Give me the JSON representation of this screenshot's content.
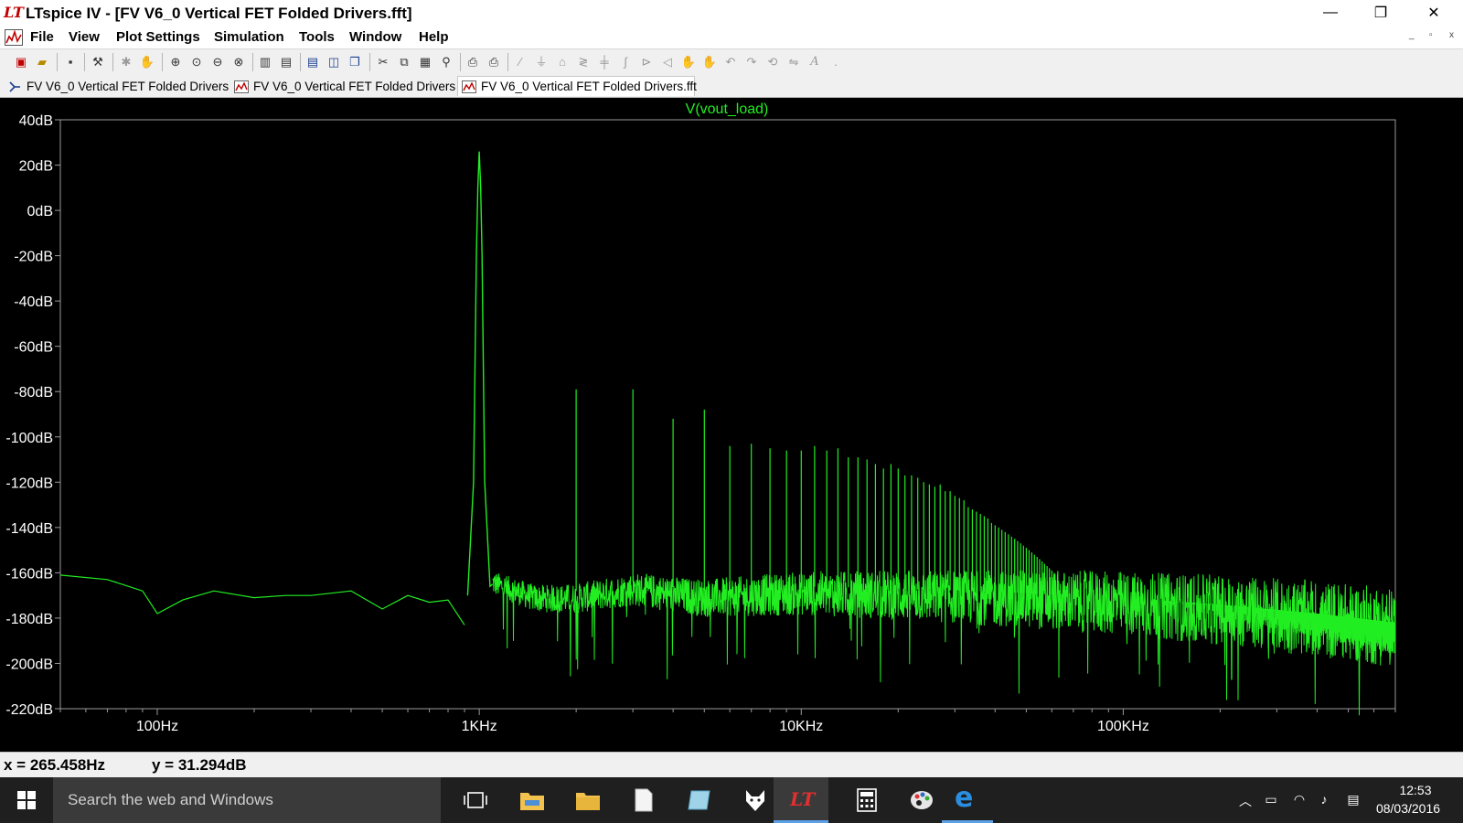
{
  "window": {
    "app_icon_label": "LT",
    "title": "LTspice IV - [FV V6_0 Vertical FET Folded Drivers.fft]",
    "minimize_glyph": "—",
    "restore_glyph": "❐",
    "close_glyph": "✕"
  },
  "menu": {
    "items": [
      {
        "label": "File",
        "id": "file"
      },
      {
        "label": "View",
        "id": "view"
      },
      {
        "label": "Plot Settings",
        "id": "plot-settings"
      },
      {
        "label": "Simulation",
        "id": "simulation"
      },
      {
        "label": "Tools",
        "id": "tools"
      },
      {
        "label": "Window",
        "id": "window"
      },
      {
        "label": "Help",
        "id": "help"
      }
    ],
    "mdi_minimize": "_",
    "mdi_restore": "▫",
    "mdi_close": "x"
  },
  "tabs": [
    {
      "label": "FV V6_0 Vertical FET Folded Drivers",
      "icon": "schematic-icon",
      "active": false
    },
    {
      "label": "FV V6_0 Vertical FET Folded Drivers",
      "icon": "waveform-icon",
      "active": false
    },
    {
      "label": "FV V6_0 Vertical FET Folded Drivers.fft",
      "icon": "waveform-icon",
      "active": true
    }
  ],
  "toolbar": {
    "icons": [
      "new-schematic-icon",
      "open-icon",
      "save-icon",
      "control-panel-icon",
      "run-icon",
      "halt-icon",
      "zoom-in-icon",
      "zoom-full-icon",
      "zoom-out-icon",
      "zoom-cancel-icon",
      "autorange-icon",
      "add-trace-icon",
      "tile-horizontal-icon",
      "tile-vertical-icon",
      "cascade-icon",
      "cut-icon",
      "copy-icon",
      "paste-icon",
      "find-icon",
      "print-preview-icon",
      "print-icon",
      "wire-icon",
      "ground-icon",
      "label-net-icon",
      "resistor-icon",
      "capacitor-icon",
      "inductor-icon",
      "diode-icon",
      "component-icon",
      "move-icon",
      "drag-icon",
      "undo-icon",
      "redo-icon",
      "rotate-icon",
      "mirror-icon",
      "text-icon",
      "spice-directive-icon"
    ]
  },
  "colors": {
    "plot_background": "#000000",
    "trace": "#22ee22",
    "axis": "#9a9a9a",
    "tick_text": "#ffffff"
  },
  "chart_data": {
    "type": "line",
    "title": "V(vout_load)",
    "xscale": "log",
    "xlim": [
      50,
      700000
    ],
    "ylim": [
      -220,
      40
    ],
    "yticks": [
      "40dB",
      "20dB",
      "0dB",
      "-20dB",
      "-40dB",
      "-60dB",
      "-80dB",
      "-100dB",
      "-120dB",
      "-140dB",
      "-160dB",
      "-180dB",
      "-200dB",
      "-220dB"
    ],
    "ytick_values": [
      40,
      20,
      0,
      -20,
      -40,
      -60,
      -80,
      -100,
      -120,
      -140,
      -160,
      -180,
      -200,
      -220
    ],
    "xticks": [
      "100Hz",
      "1KHz",
      "10KHz",
      "100KHz"
    ],
    "xtick_values": [
      100,
      1000,
      10000,
      100000
    ],
    "series": [
      {
        "fundamental_hz": 1000,
        "fundamental_db": 26,
        "noise_floor": [
          [
            50,
            -161
          ],
          [
            70,
            -163
          ],
          [
            90,
            -168
          ],
          [
            100,
            -178
          ],
          [
            120,
            -172
          ],
          [
            150,
            -168
          ],
          [
            200,
            -171
          ],
          [
            250,
            -170
          ],
          [
            300,
            -170
          ],
          [
            400,
            -168
          ],
          [
            500,
            -176
          ],
          [
            600,
            -170
          ],
          [
            700,
            -173
          ],
          [
            800,
            -172
          ],
          [
            900,
            -183
          ],
          [
            950,
            -168
          ],
          [
            1100,
            -165
          ],
          [
            1500,
            -172
          ],
          [
            2000,
            -172
          ],
          [
            3000,
            -168
          ],
          [
            5000,
            -172
          ],
          [
            10000,
            -170
          ],
          [
            20000,
            -171
          ],
          [
            50000,
            -173
          ],
          [
            100000,
            -175
          ],
          [
            200000,
            -178
          ],
          [
            400000,
            -182
          ],
          [
            700000,
            -186
          ]
        ],
        "harmonics_db": [
          -79,
          -79,
          -92,
          -88,
          -104,
          -103,
          -105,
          -106,
          -106,
          -104,
          -106,
          -105,
          -109,
          -109,
          -110,
          -112,
          -114,
          -112,
          -114,
          -117,
          -117,
          -118,
          -120,
          -121,
          -122,
          -121,
          -124,
          -124,
          -126,
          -127,
          -128,
          -131,
          -132,
          -133,
          -134,
          -135,
          -136,
          -138,
          -139,
          -140,
          -141,
          -142,
          -143,
          -144,
          -145,
          -146,
          -147,
          -148,
          -149,
          -150,
          -151,
          -152,
          -153,
          -154,
          -155,
          -156,
          -157,
          -158,
          -159,
          -160
        ]
      }
    ]
  },
  "status": {
    "cursor_x": "x = 265.458Hz",
    "cursor_y": "y = 31.294dB"
  },
  "taskbar": {
    "search_placeholder": "Search the web and Windows",
    "time": "12:53",
    "date": "08/03/2016",
    "task_icons": [
      "task-view-icon",
      "file-explorer-icon",
      "folder-icon",
      "document-icon",
      "sticky-notes-icon",
      "fox-app-icon",
      "ltspice-icon",
      "calculator-icon",
      "paint-icon",
      "edge-icon"
    ],
    "tray_icons": [
      "chevron-up-icon",
      "battery-icon",
      "wifi-icon",
      "volume-icon",
      "notifications-icon"
    ]
  }
}
